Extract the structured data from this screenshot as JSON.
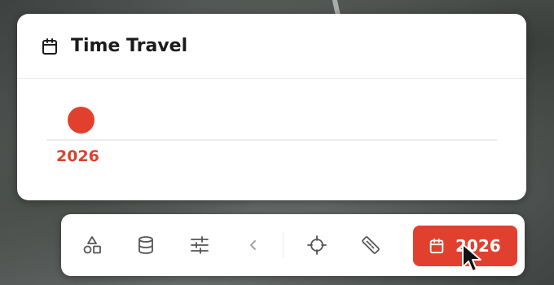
{
  "panel": {
    "title": "Time Travel",
    "selected_year": "2026",
    "icon": "calendar-icon"
  },
  "toolbar": {
    "tools": [
      {
        "name": "shapes-tool",
        "icon": "shapes-icon"
      },
      {
        "name": "layers-tool",
        "icon": "database-icon"
      },
      {
        "name": "settings-tool",
        "icon": "sliders-icon"
      },
      {
        "name": "collapse-tool",
        "icon": "chevron-left-icon"
      },
      {
        "name": "locate-tool",
        "icon": "crosshair-icon"
      },
      {
        "name": "measure-tool",
        "icon": "ruler-icon"
      }
    ],
    "time_button_label": "2026",
    "time_button_icon": "calendar-icon"
  },
  "colors": {
    "accent": "#e2402e",
    "panel_bg": "#ffffff",
    "icon": "#555555"
  }
}
